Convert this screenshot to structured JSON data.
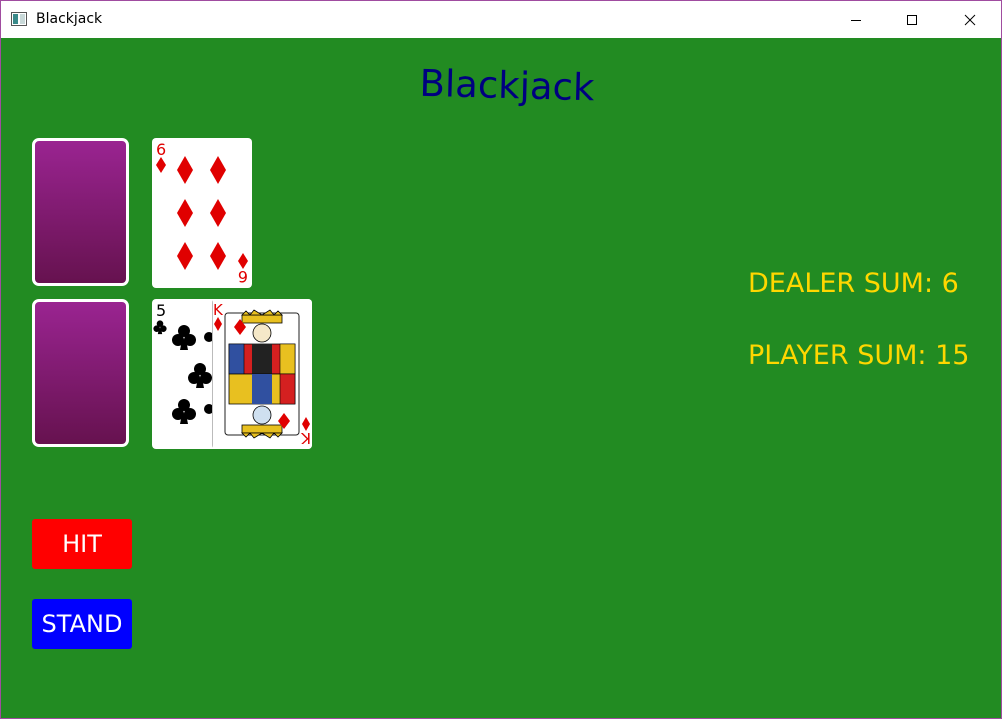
{
  "window": {
    "title": "Blackjack"
  },
  "game": {
    "title": "Blackjack"
  },
  "dealer": {
    "hidden_card": "card-back",
    "visible_card": {
      "rank": "6",
      "suit": "diamonds"
    },
    "sum_label": "DEALER SUM: 6"
  },
  "player": {
    "hidden_card": "card-back",
    "cards": [
      {
        "rank": "5",
        "suit": "clubs"
      },
      {
        "rank": "K",
        "suit": "diamonds"
      }
    ],
    "sum_label": "PLAYER SUM: 15"
  },
  "buttons": {
    "hit": "HIT",
    "stand": "STAND"
  },
  "colors": {
    "table": "#228b22",
    "title": "#000080",
    "sums": "#ffd700",
    "hit": "#ff0000",
    "stand": "#0000ff",
    "card_back": "#8e1f83"
  }
}
